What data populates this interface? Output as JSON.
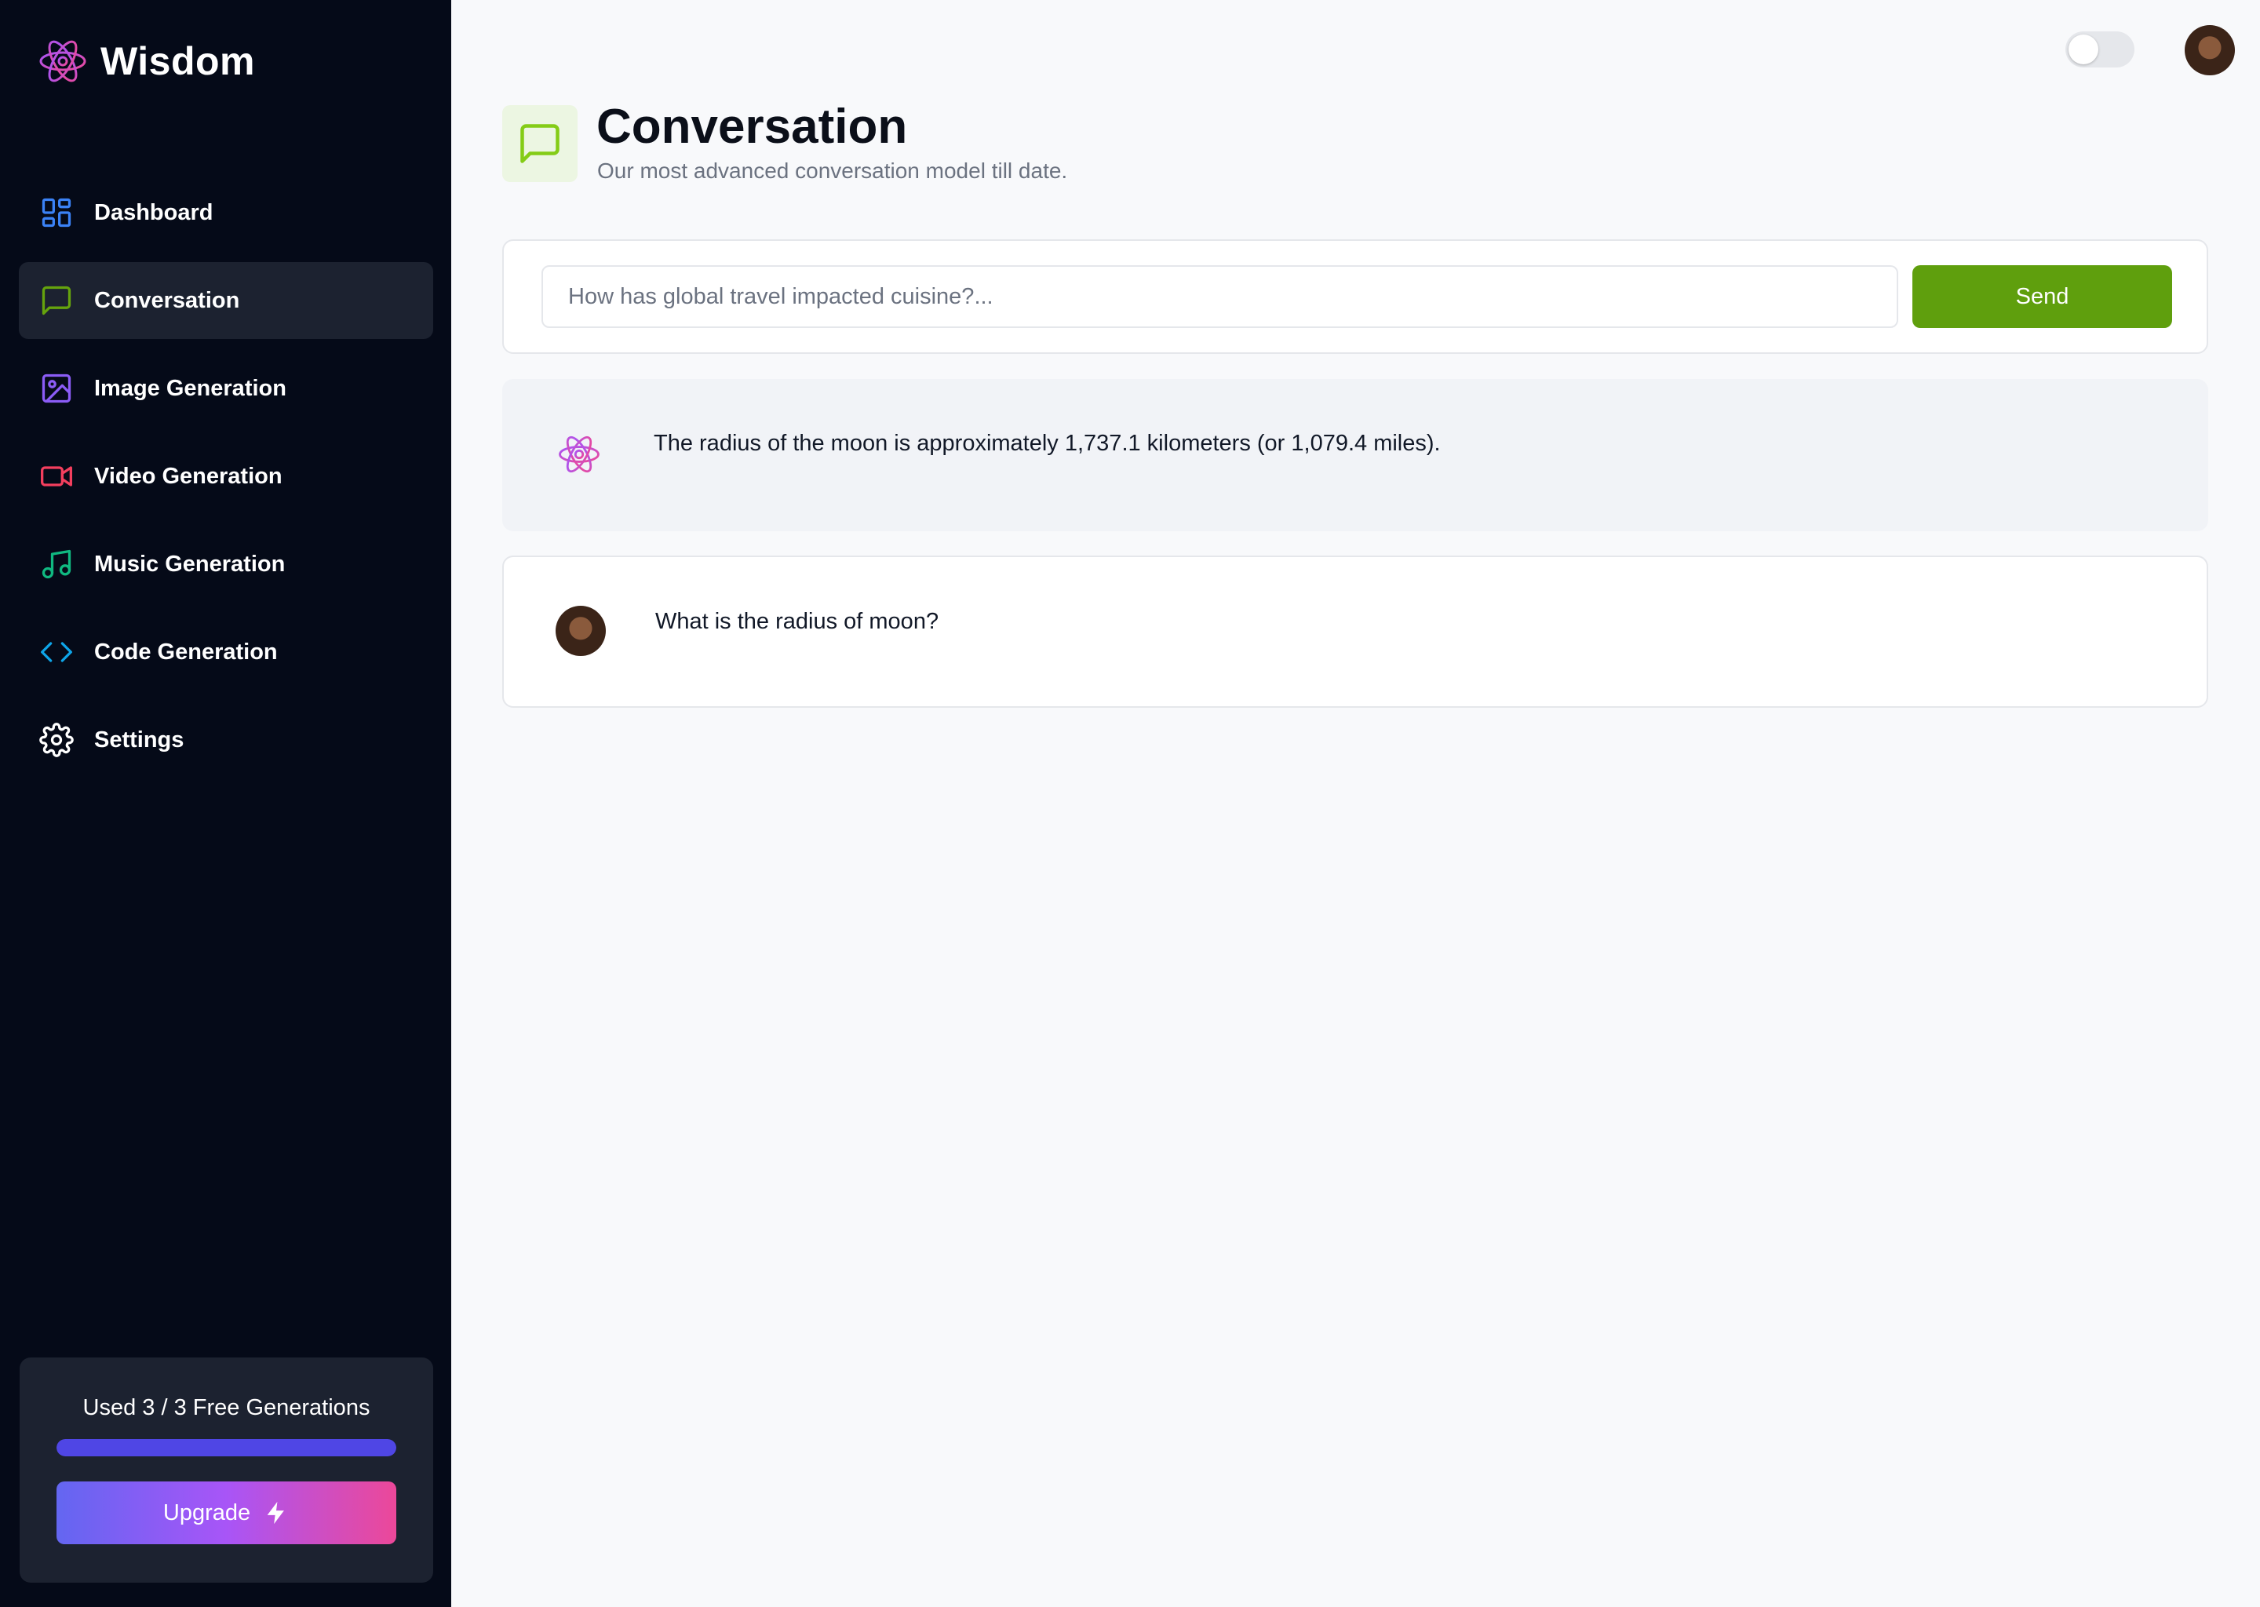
{
  "app": {
    "name": "Wisdom"
  },
  "sidebar": {
    "items": [
      {
        "label": "Dashboard",
        "icon": "dashboard-icon",
        "color": "#3b82f6",
        "active": false
      },
      {
        "label": "Conversation",
        "icon": "message-square-icon",
        "color": "#65a30d",
        "active": true
      },
      {
        "label": "Image Generation",
        "icon": "image-icon",
        "color": "#8b5cf6",
        "active": false
      },
      {
        "label": "Video Generation",
        "icon": "video-icon",
        "color": "#f43f5e",
        "active": false
      },
      {
        "label": "Music Generation",
        "icon": "music-icon",
        "color": "#10b981",
        "active": false
      },
      {
        "label": "Code Generation",
        "icon": "code-icon",
        "color": "#0ea5e9",
        "active": false
      },
      {
        "label": "Settings",
        "icon": "gear-icon",
        "color": "#ffffff",
        "active": false
      }
    ],
    "usage": {
      "text": "Used 3 / 3 Free Generations",
      "used": 3,
      "limit": 3,
      "progress_fraction": 1.0,
      "progress_color": "#4f46e5"
    },
    "upgrade_label": "Upgrade"
  },
  "topbar": {
    "theme_toggle_on": false
  },
  "header": {
    "title": "Conversation",
    "subtitle": "Our most advanced conversation model till date.",
    "icon_color": "#84cc16"
  },
  "prompt": {
    "placeholder": "How has global travel impacted cuisine?...",
    "value": "",
    "send_label": "Send",
    "send_color": "#5f9f0d"
  },
  "messages": [
    {
      "role": "bot",
      "text": "The radius of the moon is approximately 1,737.1 kilometers (or 1,079.4 miles)."
    },
    {
      "role": "user",
      "text": "What is the radius of moon?"
    }
  ]
}
